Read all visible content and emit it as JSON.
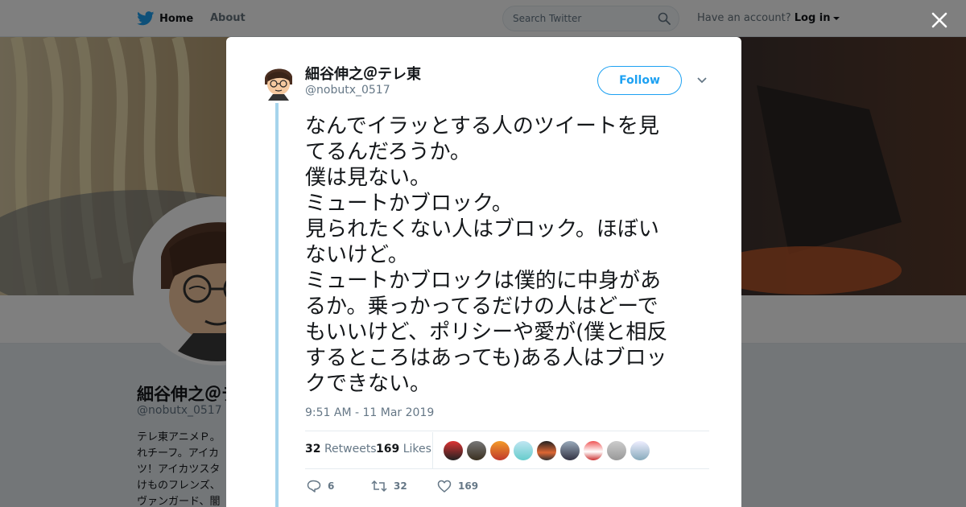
{
  "topbar": {
    "home_label": "Home",
    "about_label": "About",
    "search_placeholder": "Search Twitter",
    "account_prompt": "Have an account?",
    "login_label": "Log in"
  },
  "profile": {
    "name": "細谷伸之＠テ",
    "handle": "@nobutx_0517",
    "bio_lines": [
      "テレ東アニメＰ。",
      "れチーフ。アイカ",
      "ツ！アイカツスタ",
      "けものフレンズ、",
      "ヴァンガード、闇"
    ]
  },
  "tweet": {
    "author_name": "細谷伸之＠テレ東",
    "author_handle": "@nobutx_0517",
    "follow_label": "Follow",
    "text": "なんでイラッとする人のツイートを見\nてるんだろうか。\n僕は見ない。\nミュートかブロック。\n見られたくない人はブロック。ほぼい\nないけど。\nミュートかブロックは僕的に中身があ\nるか。乗っかってるだけの人はどーで\nもいいけど、ポリシーや愛が(僕と相反\nするところはあっても)ある人はブロッ\nクできない。",
    "timestamp": "9:51 AM - 11 Mar 2019",
    "retweets_count": "32",
    "retweets_label": "Retweets",
    "likes_count": "169",
    "likes_label": "Likes",
    "reply_count": "6",
    "retweet_action_count": "32",
    "like_action_count": "169"
  },
  "colors": {
    "brand_blue": "#1da1f2",
    "thread_line": "#a6d4ec",
    "overlay": "rgba(0,0,0,0.5)"
  },
  "likers": [
    "liker-1",
    "liker-2",
    "liker-3",
    "liker-4",
    "liker-5",
    "liker-6",
    "liker-7",
    "liker-8",
    "liker-9"
  ]
}
